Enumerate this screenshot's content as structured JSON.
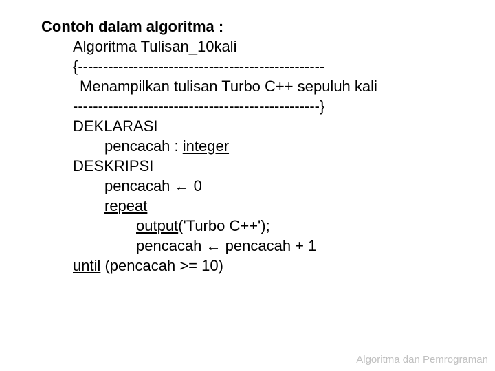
{
  "heading": "Contoh dalam algoritma :",
  "line_algoritma": "Algoritma Tulisan_10kali",
  "line_open": "{-------------------------------------------------",
  "line_desc": "Menampilkan tulisan Turbo C++ sepuluh kali",
  "line_close": "-------------------------------------------------}",
  "kw_deklarasi": "DEKLARASI",
  "decl_pencacah_pre": "pencacah : ",
  "decl_integer": "integer",
  "kw_deskripsi": "DESKRIPSI",
  "assign_pencacah": "pencacah ← 0",
  "kw_repeat": "repeat",
  "call_output": "output",
  "call_output_args": "('Turbo C++');",
  "incr_pencacah": "pencacah ← pencacah + 1",
  "kw_until": "until",
  "until_cond": " (pencacah >= 10)",
  "footer": "Algoritma dan Pemrograman"
}
